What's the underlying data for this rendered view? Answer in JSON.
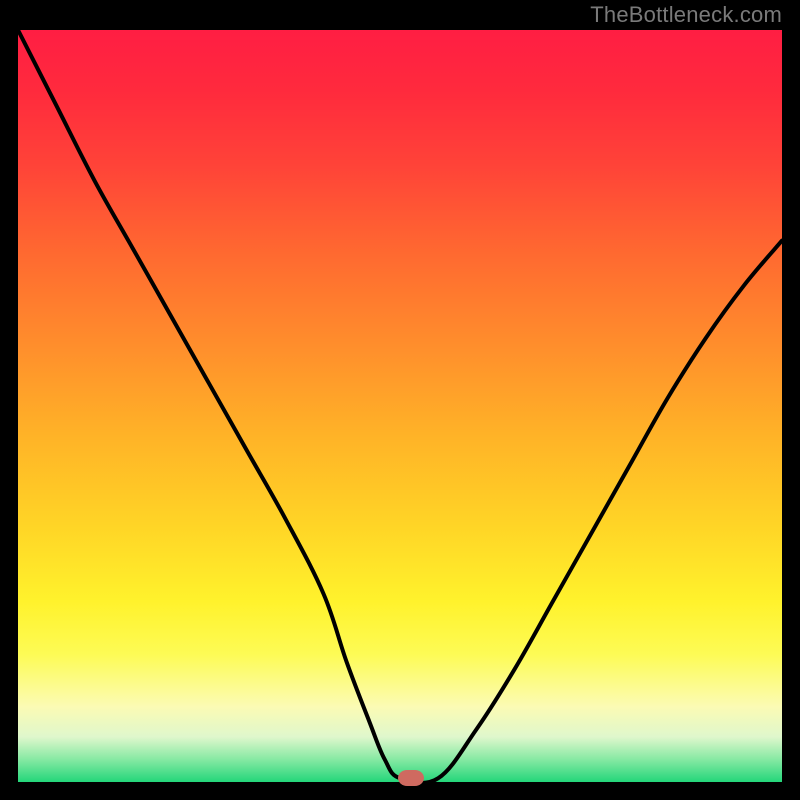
{
  "watermark": "TheBottleneck.com",
  "chart_data": {
    "type": "line",
    "title": "",
    "xlabel": "",
    "ylabel": "",
    "xlim": [
      0,
      100
    ],
    "ylim": [
      0,
      100
    ],
    "grid": false,
    "series": [
      {
        "name": "curve",
        "x": [
          0,
          5,
          10,
          15,
          20,
          25,
          30,
          35,
          40,
          43,
          46,
          48,
          50,
          55,
          60,
          65,
          70,
          75,
          80,
          85,
          90,
          95,
          100
        ],
        "y": [
          100,
          90,
          80,
          71,
          62,
          53,
          44,
          35,
          25,
          16,
          8,
          3,
          0.5,
          0.5,
          7,
          15,
          24,
          33,
          42,
          51,
          59,
          66,
          72
        ]
      }
    ],
    "flat_region": {
      "x_start": 48,
      "x_end": 55,
      "y": 0.5
    },
    "marker": {
      "x": 51.5,
      "y": 0.5,
      "color": "#cf6a60"
    },
    "background_gradient": {
      "top": "#ff1e43",
      "middle": "#ffd526",
      "bottom": "#24d67a"
    }
  }
}
